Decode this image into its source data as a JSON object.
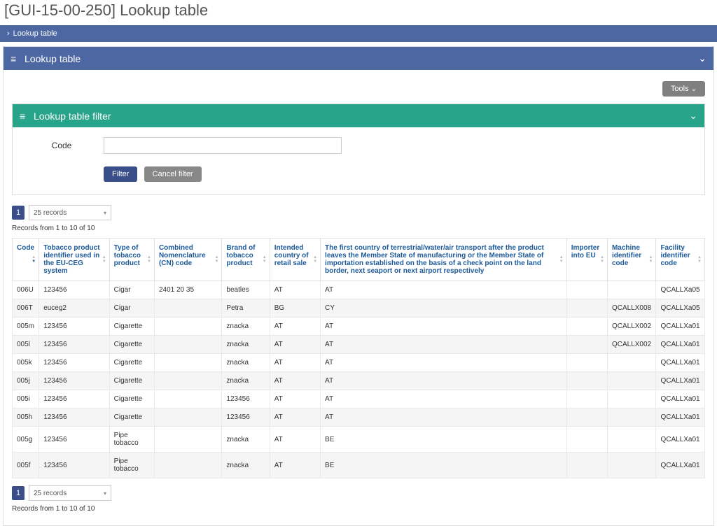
{
  "page": {
    "title": "[GUI-15-00-250] Lookup table",
    "breadcrumb": "Lookup table"
  },
  "mainPanel": {
    "title": "Lookup table"
  },
  "tools": {
    "label": "Tools"
  },
  "filterPanel": {
    "title": "Lookup table filter",
    "codeLabel": "Code",
    "codeValue": "",
    "filterBtn": "Filter",
    "cancelBtn": "Cancel filter"
  },
  "pager": {
    "page": "1",
    "pageSize": "25 records",
    "info": "Records from 1 to 10 of 10"
  },
  "tableHeaders": {
    "code": "Code",
    "tpi": "Tobacco product identifier used in the EU-CEG system",
    "type": "Type of tobacco product",
    "cn": "Combined Nomenclature (CN) code",
    "brand": "Brand of tobacco product",
    "country": "Intended country of retail sale",
    "first": "The first country of terrestrial/water/air transport after the product leaves the Member State of manufacturing or the Member State of importation established on the basis of a check point on the land border, next seaport or next airport respectively",
    "importer": "Importer into EU",
    "machine": "Machine identifier code",
    "facility": "Facility identifier code"
  },
  "rows": [
    {
      "code": "006U",
      "tpi": "123456",
      "type": "Cigar",
      "cn": "2401 20 35",
      "brand": "beatles",
      "country": "AT",
      "first": "AT",
      "importer": "",
      "machine": "",
      "facility": "QCALLXa05"
    },
    {
      "code": "006T",
      "tpi": "euceg2",
      "type": "Cigar",
      "cn": "",
      "brand": "Petra",
      "country": "BG",
      "first": "CY",
      "importer": "",
      "machine": "QCALLX008",
      "facility": "QCALLXa05"
    },
    {
      "code": "005m",
      "tpi": "123456",
      "type": "Cigarette",
      "cn": "",
      "brand": "znacka",
      "country": "AT",
      "first": "AT",
      "importer": "",
      "machine": "QCALLX002",
      "facility": "QCALLXa01"
    },
    {
      "code": "005l",
      "tpi": "123456",
      "type": "Cigarette",
      "cn": "",
      "brand": "znacka",
      "country": "AT",
      "first": "AT",
      "importer": "",
      "machine": "QCALLX002",
      "facility": "QCALLXa01"
    },
    {
      "code": "005k",
      "tpi": "123456",
      "type": "Cigarette",
      "cn": "",
      "brand": "znacka",
      "country": "AT",
      "first": "AT",
      "importer": "",
      "machine": "",
      "facility": "QCALLXa01"
    },
    {
      "code": "005j",
      "tpi": "123456",
      "type": "Cigarette",
      "cn": "",
      "brand": "znacka",
      "country": "AT",
      "first": "AT",
      "importer": "",
      "machine": "",
      "facility": "QCALLXa01"
    },
    {
      "code": "005i",
      "tpi": "123456",
      "type": "Cigarette",
      "cn": "",
      "brand": "123456",
      "country": "AT",
      "first": "AT",
      "importer": "",
      "machine": "",
      "facility": "QCALLXa01"
    },
    {
      "code": "005h",
      "tpi": "123456",
      "type": "Cigarette",
      "cn": "",
      "brand": "123456",
      "country": "AT",
      "first": "AT",
      "importer": "",
      "machine": "",
      "facility": "QCALLXa01"
    },
    {
      "code": "005g",
      "tpi": "123456",
      "type": "Pipe tobacco",
      "cn": "",
      "brand": "znacka",
      "country": "AT",
      "first": "BE",
      "importer": "",
      "machine": "",
      "facility": "QCALLXa01"
    },
    {
      "code": "005f",
      "tpi": "123456",
      "type": "Pipe tobacco",
      "cn": "",
      "brand": "znacka",
      "country": "AT",
      "first": "BE",
      "importer": "",
      "machine": "",
      "facility": "QCALLXa01"
    }
  ]
}
